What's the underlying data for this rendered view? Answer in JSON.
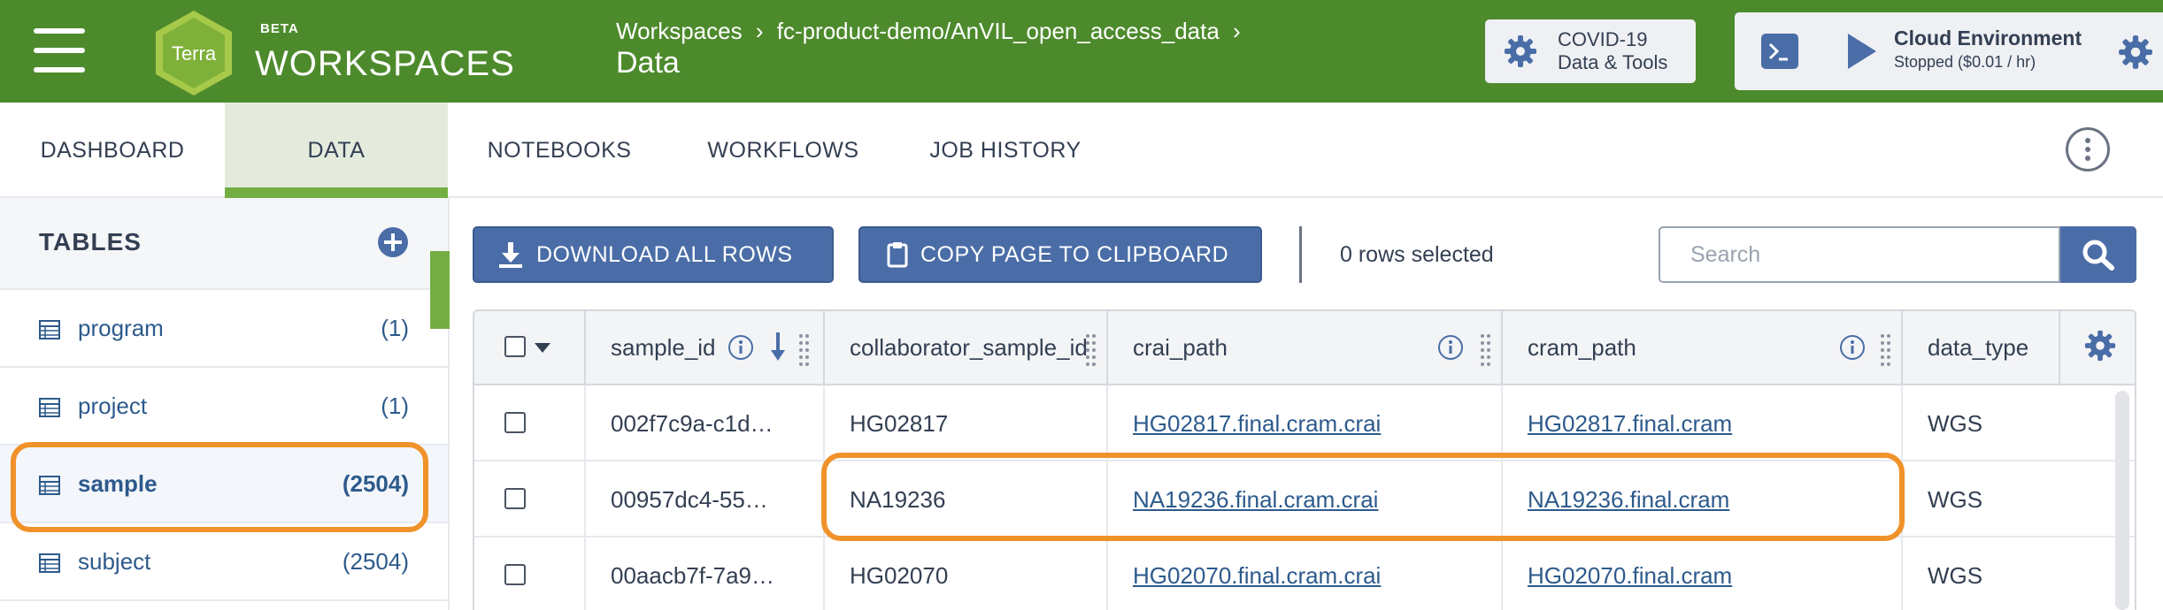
{
  "header": {
    "beta": "BETA",
    "brand": "WORKSPACES",
    "logo_text": "Terra",
    "breadcrumb": [
      "Workspaces",
      "fc-product-demo/AnVIL_open_access_data"
    ],
    "breadcrumb_sep": "›",
    "page_title": "Data",
    "covid_button": {
      "line1": "COVID-19",
      "line2": "Data & Tools"
    },
    "cloud": {
      "title": "Cloud Environment",
      "status": "Stopped ($0.01 / hr)"
    }
  },
  "tabs": [
    {
      "label": "DASHBOARD",
      "active": false
    },
    {
      "label": "DATA",
      "active": true
    },
    {
      "label": "NOTEBOOKS",
      "active": false
    },
    {
      "label": "WORKFLOWS",
      "active": false
    },
    {
      "label": "JOB HISTORY",
      "active": false
    }
  ],
  "sidebar": {
    "title": "TABLES",
    "items": [
      {
        "name": "program",
        "count": "(1)"
      },
      {
        "name": "project",
        "count": "(1)"
      },
      {
        "name": "sample",
        "count": "(2504)",
        "selected": true
      },
      {
        "name": "subject",
        "count": "(2504)"
      }
    ]
  },
  "toolbar": {
    "download_label": "DOWNLOAD ALL ROWS",
    "copy_label": "COPY PAGE TO CLIPBOARD",
    "rows_selected": "0 rows selected",
    "search_placeholder": "Search"
  },
  "table": {
    "columns": [
      "sample_id",
      "collaborator_sample_id",
      "crai_path",
      "cram_path",
      "data_type"
    ],
    "rows": [
      {
        "sample_id": "002f7c9a-c1d…",
        "collaborator_sample_id": "HG02817",
        "crai_path": "HG02817.final.cram.crai",
        "cram_path": "HG02817.final.cram",
        "data_type": "WGS"
      },
      {
        "sample_id": "00957dc4-55…",
        "collaborator_sample_id": "NA19236",
        "crai_path": "NA19236.final.cram.crai",
        "cram_path": "NA19236.final.cram",
        "data_type": "WGS"
      },
      {
        "sample_id": "00aacb7f-7a9…",
        "collaborator_sample_id": "HG02070",
        "crai_path": "HG02070.final.cram.crai",
        "cram_path": "HG02070.final.cram",
        "data_type": "WGS"
      }
    ]
  },
  "colors": {
    "header_green": "#4d8a2c",
    "accent_green": "#74ae43",
    "primary_blue": "#4a6da7",
    "link_blue": "#2d5a8c",
    "highlight_orange": "#f0922a"
  }
}
